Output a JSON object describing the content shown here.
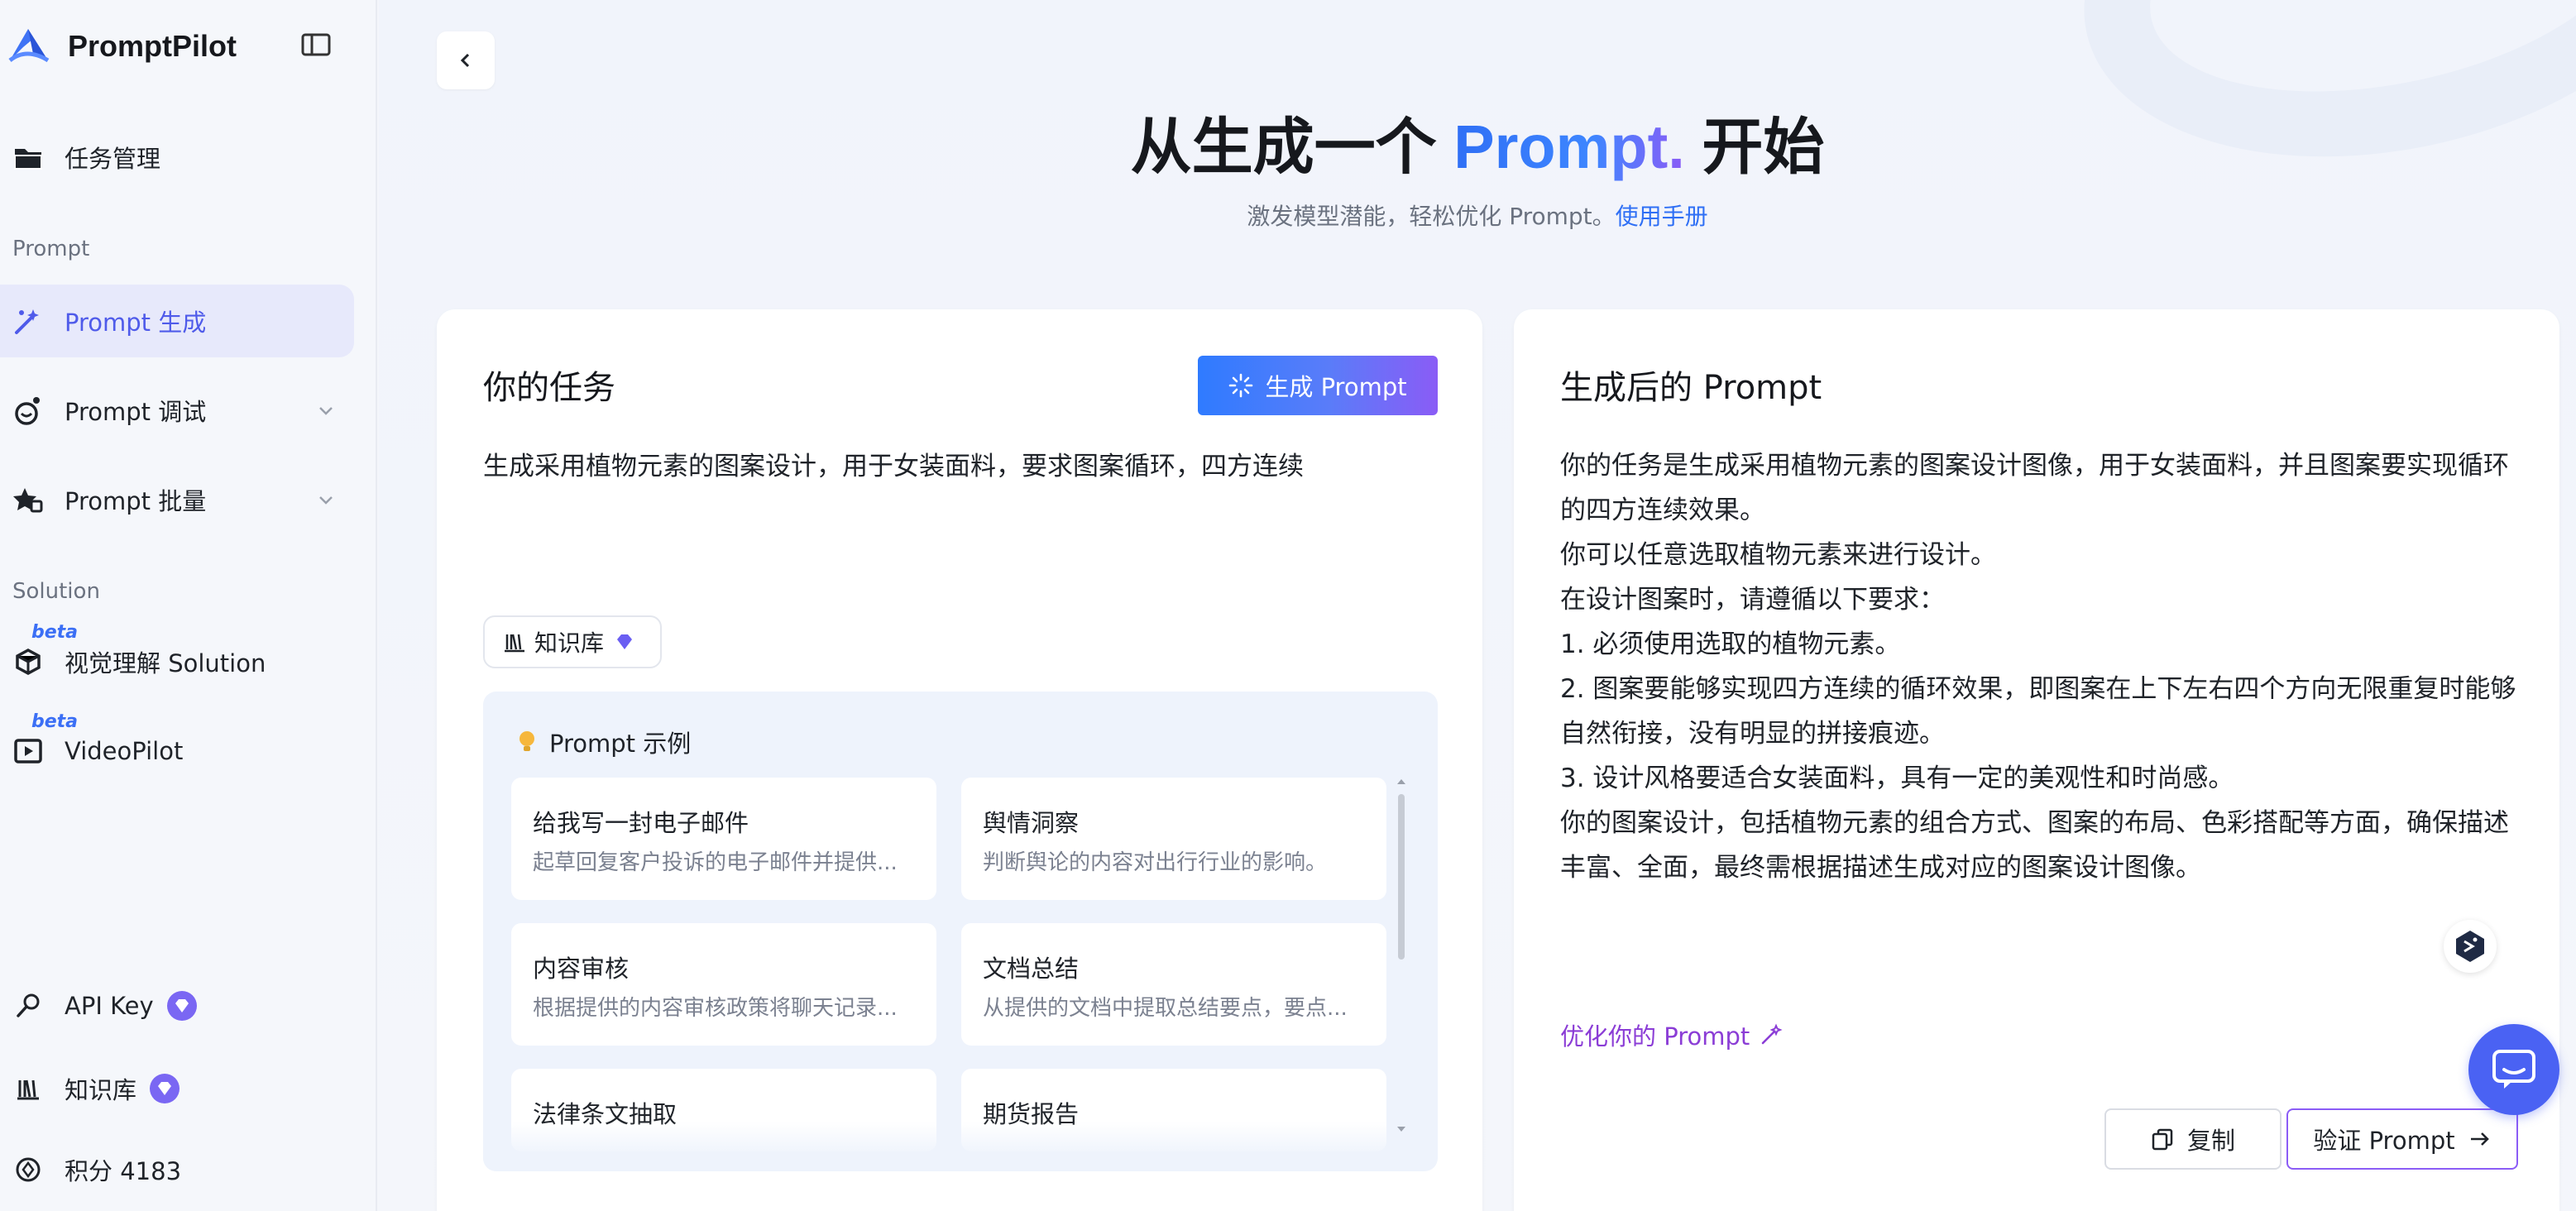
{
  "brand": {
    "name": "PromptPilot"
  },
  "sidebar": {
    "task_manage": "任务管理",
    "section_prompt": "Prompt",
    "prompt_generate": "Prompt 生成",
    "prompt_debug": "Prompt 调试",
    "prompt_batch": "Prompt 批量",
    "section_solution": "Solution",
    "beta": "beta",
    "visual_solution": "视觉理解 Solution",
    "videopilot": "VideoPilot",
    "api_key": "API Key",
    "knowledge_base": "知识库",
    "points": "积分 4183"
  },
  "hero": {
    "title_pre": "从生成一个 ",
    "title_accent": "Prompt.",
    "title_post": " 开始",
    "subtitle": "激发模型潜能，轻松优化 Prompt。",
    "manual_link": "使用手册"
  },
  "task_card": {
    "title": "你的任务",
    "generate_button": "生成 Prompt",
    "task_text": "生成采用植物元素的图案设计，用于女装面料，要求图案循环，四方连续",
    "kb_chip": "知识库",
    "examples_title": "Prompt 示例",
    "examples": [
      {
        "title": "给我写一封电子邮件",
        "desc": "起草回复客户投诉的电子邮件并提供..."
      },
      {
        "title": "舆情洞察",
        "desc": "判断舆论的内容对出行行业的影响。"
      },
      {
        "title": "内容审核",
        "desc": "根据提供的内容审核政策将聊天记录..."
      },
      {
        "title": "文档总结",
        "desc": "从提供的文档中提取总结要点，要点..."
      },
      {
        "title": "法律条文抽取",
        "desc": ""
      },
      {
        "title": "期货报告",
        "desc": ""
      }
    ]
  },
  "output_card": {
    "title": "生成后的 Prompt",
    "lines": [
      "你的任务是生成采用植物元素的图案设计图像，用于女装面料，并且图案要实现循环的四方连续效果。",
      "你可以任意选取植物元素来进行设计。",
      "在设计图案时，请遵循以下要求：",
      "1. 必须使用选取的植物元素。",
      "2. 图案要能够实现四方连续的循环效果，即图案在上下左右四个方向无限重复时能够自然衔接，没有明显的拼接痕迹。",
      "3. 设计风格要适合女装面料，具有一定的美观性和时尚感。",
      "你的图案设计，包括植物元素的组合方式、图案的布局、色彩搭配等方面，确保描述丰富、全面，最终需根据描述生成对应的图案设计图像。"
    ],
    "optimize_link": "优化你的 Prompt",
    "copy_button": "复制",
    "verify_button": "验证 Prompt"
  }
}
